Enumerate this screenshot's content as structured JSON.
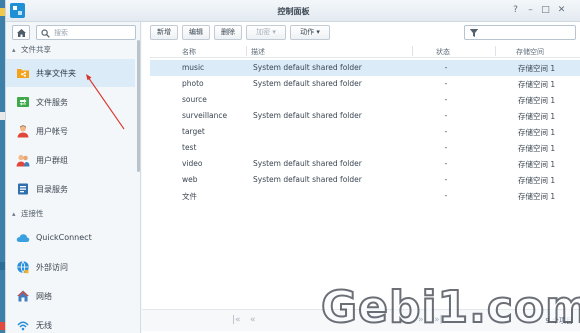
{
  "window": {
    "title": "控制面板",
    "controls": [
      "?",
      "–",
      "□",
      "✕"
    ]
  },
  "sidebar": {
    "search_placeholder": "搜索",
    "sections": [
      {
        "label": "文件共享"
      },
      {
        "label": "连接性"
      }
    ],
    "items": [
      {
        "label": "共享文件夹",
        "icon": "shared-folder-icon"
      },
      {
        "label": "文件服务",
        "icon": "file-services-icon"
      },
      {
        "label": "用户帐号",
        "icon": "user-icon"
      },
      {
        "label": "用户群组",
        "icon": "group-icon"
      },
      {
        "label": "目录服务",
        "icon": "directory-icon"
      },
      {
        "label": "QuickConnect",
        "icon": "quickconnect-icon"
      },
      {
        "label": "外部访问",
        "icon": "external-access-icon"
      },
      {
        "label": "网络",
        "icon": "network-icon"
      },
      {
        "label": "无线",
        "icon": "wireless-icon"
      }
    ]
  },
  "toolbar": {
    "create": "新增",
    "edit": "编辑",
    "delete": "删除",
    "encrypt": "加密 ▾",
    "action": "动作 ▾"
  },
  "table": {
    "columns": [
      "名称",
      "描述",
      "状态",
      "存储空间"
    ],
    "rows": [
      {
        "name": "music",
        "desc": "System default shared folder",
        "status": "-",
        "volume": "存储空间 1"
      },
      {
        "name": "photo",
        "desc": "System default shared folder",
        "status": "-",
        "volume": "存储空间 1"
      },
      {
        "name": "source",
        "desc": "",
        "status": "-",
        "volume": "存储空间 1"
      },
      {
        "name": "surveillance",
        "desc": "System default shared folder",
        "status": "-",
        "volume": "存储空间 1"
      },
      {
        "name": "target",
        "desc": "",
        "status": "-",
        "volume": "存储空间 1"
      },
      {
        "name": "test",
        "desc": "",
        "status": "-",
        "volume": "存储空间 1"
      },
      {
        "name": "video",
        "desc": "System default shared folder",
        "status": "-",
        "volume": "存储空间 1"
      },
      {
        "name": "web",
        "desc": "System default shared folder",
        "status": "-",
        "volume": "存储空间 1"
      },
      {
        "name": "文件",
        "desc": "",
        "status": "-",
        "volume": "存储空间 1"
      }
    ]
  },
  "pager": {
    "first": "|«",
    "prev": "«",
    "next": "»",
    "last": "»|",
    "count": "9 个项目"
  },
  "watermark": "Gebi1.com",
  "colors": {
    "accent": "#1f90d6",
    "selection": "#dcebf8",
    "annotation_arrow": "#d9342b"
  }
}
